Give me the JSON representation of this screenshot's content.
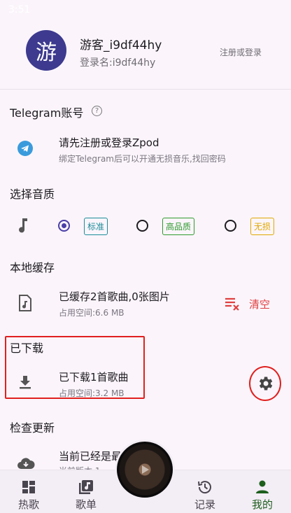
{
  "status": {
    "time": "3:51"
  },
  "profile": {
    "avatar_char": "游",
    "username": "游客_i9df44hy",
    "login_name": "登录名:i9df44hy",
    "register_link": "注册或登录"
  },
  "telegram": {
    "title": "Telegram账号",
    "row_title": "请先注册或登录Zpod",
    "row_sub": "绑定Telegram后可以开通无损音乐,找回密码"
  },
  "quality": {
    "title": "选择音质",
    "options": [
      {
        "label": "标准",
        "selected": true,
        "color": "#1b8c9a"
      },
      {
        "label": "高品质",
        "selected": false,
        "color": "#2e9a2e"
      },
      {
        "label": "无损",
        "selected": false,
        "color": "#e0a800"
      }
    ]
  },
  "cache": {
    "title": "本地缓存",
    "row_title": "已缓存2首歌曲,0张图片",
    "row_sub": "占用空间:6.6 MB",
    "clear_label": "清空"
  },
  "downloaded": {
    "title": "已下载",
    "row_title": "已下载1首歌曲",
    "row_sub": "占用空间:3.2 MB"
  },
  "update": {
    "title": "检查更新",
    "row_title": "当前已经是最",
    "row_sub": "当前版本 1"
  },
  "nav": {
    "items": [
      {
        "label": "热歌",
        "icon": "grid-icon"
      },
      {
        "label": "歌单",
        "icon": "playlist-icon"
      },
      {
        "label": "记录",
        "icon": "history-icon"
      },
      {
        "label": "我的",
        "icon": "person-icon",
        "active": true
      }
    ]
  },
  "colors": {
    "accent": "#4a3fa8",
    "danger": "#e0201f",
    "clear": "#e04040"
  }
}
